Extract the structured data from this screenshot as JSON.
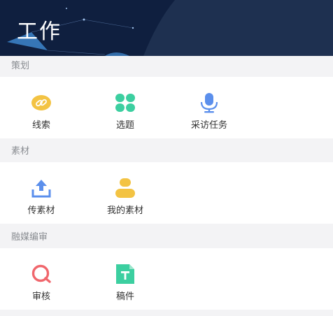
{
  "header": {
    "title": "工作"
  },
  "sections": [
    {
      "title": "策划",
      "items": [
        {
          "label": "线索",
          "icon": "link-icon",
          "color": "#f3c343"
        },
        {
          "label": "选题",
          "icon": "four-leaf-icon",
          "color": "#3ccfa0"
        },
        {
          "label": "采访任务",
          "icon": "microphone-icon",
          "color": "#5b8fec"
        }
      ]
    },
    {
      "title": "素材",
      "items": [
        {
          "label": "传素材",
          "icon": "upload-icon",
          "color": "#5b8fec"
        },
        {
          "label": "我的素材",
          "icon": "user-icon",
          "color": "#f3c343"
        }
      ]
    },
    {
      "title": "融媒编审",
      "items": [
        {
          "label": "审核",
          "icon": "review-icon",
          "color": "#f0666c"
        },
        {
          "label": "稿件",
          "icon": "document-icon",
          "color": "#3ccfa0"
        }
      ]
    }
  ]
}
